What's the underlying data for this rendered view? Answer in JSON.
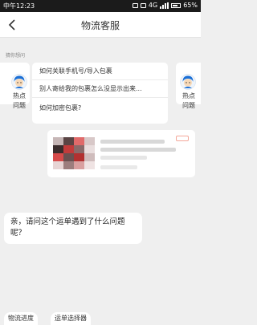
{
  "status_bar": {
    "time": "中午12:23",
    "network": "4G",
    "battery": "65%"
  },
  "header": {
    "title": "物流客服"
  },
  "guess": {
    "label": "猜你想问"
  },
  "hot_card": {
    "label_line1": "热点",
    "label_line2": "问题"
  },
  "questions": [
    "如何关联手机号/导入包裹",
    "别人寄给我的包裹怎么没显示出来...",
    "如何加密包裹?"
  ],
  "message": {
    "text": "亲，请问这个运单遇到了什么问题呢？"
  },
  "quick_actions": [
    "物流进度",
    "运单选择器"
  ],
  "colors": {
    "accent": "#ff5000",
    "avatar_hair": "#1a6fd6"
  }
}
